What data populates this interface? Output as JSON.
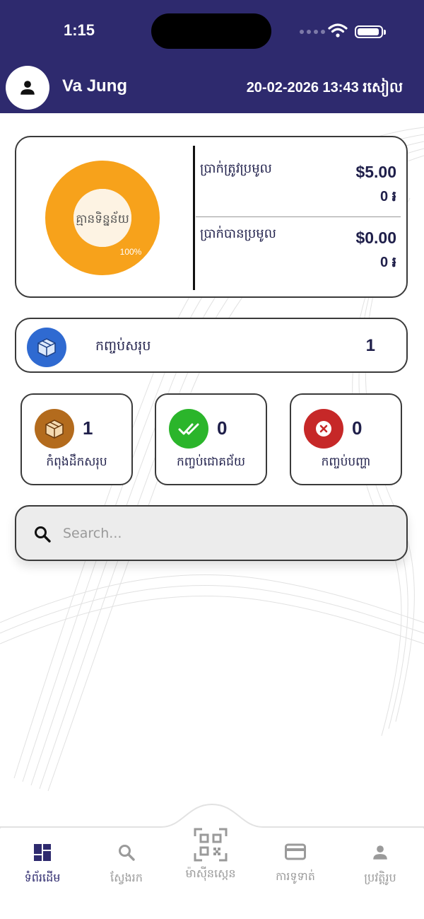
{
  "status_bar": {
    "time": "1:15"
  },
  "header": {
    "user_name": "Va Jung",
    "datetime": "20-02-2026 13:43 រសៀល",
    "avatar_icon": "person-icon"
  },
  "summary": {
    "donut": {
      "center_label": "គ្មានទិន្នន័យ",
      "percent_label": "100%",
      "color": "#f7a21b"
    },
    "to_collect": {
      "label": "ប្រាក់ត្រូវប្រមូល",
      "usd": "$5.00",
      "khr": "0 ៛"
    },
    "collected": {
      "label": "ប្រាក់បានប្រមូល",
      "usd": "$0.00",
      "khr": "0 ៛"
    }
  },
  "total_packages": {
    "label": "កញ្ចប់សរុប",
    "value": "1",
    "icon": "package-icon",
    "color": "#2f6ad1"
  },
  "stats": [
    {
      "label": "កំពុងដឹកសរុប",
      "value": "1",
      "icon": "package-icon",
      "color": "#b36b1d"
    },
    {
      "label": "កញ្ចប់ជោគជ័យ",
      "value": "0",
      "icon": "double-check-icon",
      "color": "#2bb52b"
    },
    {
      "label": "កញ្ចប់បញ្ហា",
      "value": "0",
      "icon": "cancel-icon",
      "color": "#c62828"
    }
  ],
  "search": {
    "placeholder": "Search...",
    "value": ""
  },
  "bottom_nav": [
    {
      "label": "ទំព័រដើម",
      "icon": "dashboard-icon",
      "active": true
    },
    {
      "label": "ស្វែងរក",
      "icon": "search-icon",
      "active": false
    },
    {
      "label": "ម៉ាស៊ីនស្កេន",
      "icon": "qr-code-icon",
      "active": false
    },
    {
      "label": "ការទូទាត់",
      "icon": "credit-card-icon",
      "active": false
    },
    {
      "label": "ប្រវត្តិរូប",
      "icon": "person-icon",
      "active": false
    }
  ],
  "colors": {
    "header": "#2e2a6e",
    "accent": "#2e2a6e",
    "inactive": "#9a9a9a"
  }
}
